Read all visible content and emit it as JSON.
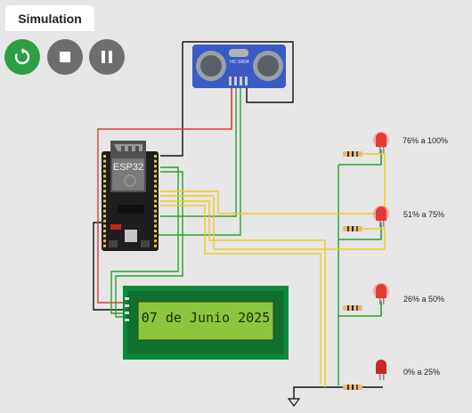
{
  "tab": {
    "label": "Simulation"
  },
  "controls": {
    "restart_icon": "restart-icon",
    "stop_icon": "stop-icon",
    "pause_icon": "pause-icon"
  },
  "esp32": {
    "label": "ESP32"
  },
  "sensor": {
    "label": "HC-SR04"
  },
  "lcd": {
    "text": "07 de Junio 2025"
  },
  "leds": [
    {
      "range": "76% a 100%",
      "state": "on"
    },
    {
      "range": "51% a 75%",
      "state": "on"
    },
    {
      "range": "26% a 50%",
      "state": "on"
    },
    {
      "range": "0% a 25%",
      "state": "off"
    }
  ],
  "colors": {
    "restart_button": "#2e9e44",
    "control_button": "#6e6e6e",
    "lcd_board": "#0a8a3a",
    "lcd_screen": "#8cc63f",
    "wire_red": "#e53935",
    "wire_green": "#2e9e2e",
    "wire_yellow": "#f2c81f",
    "wire_black": "#111111",
    "sensor_board": "#3b5bc4",
    "led_on": "#ff3b30"
  }
}
